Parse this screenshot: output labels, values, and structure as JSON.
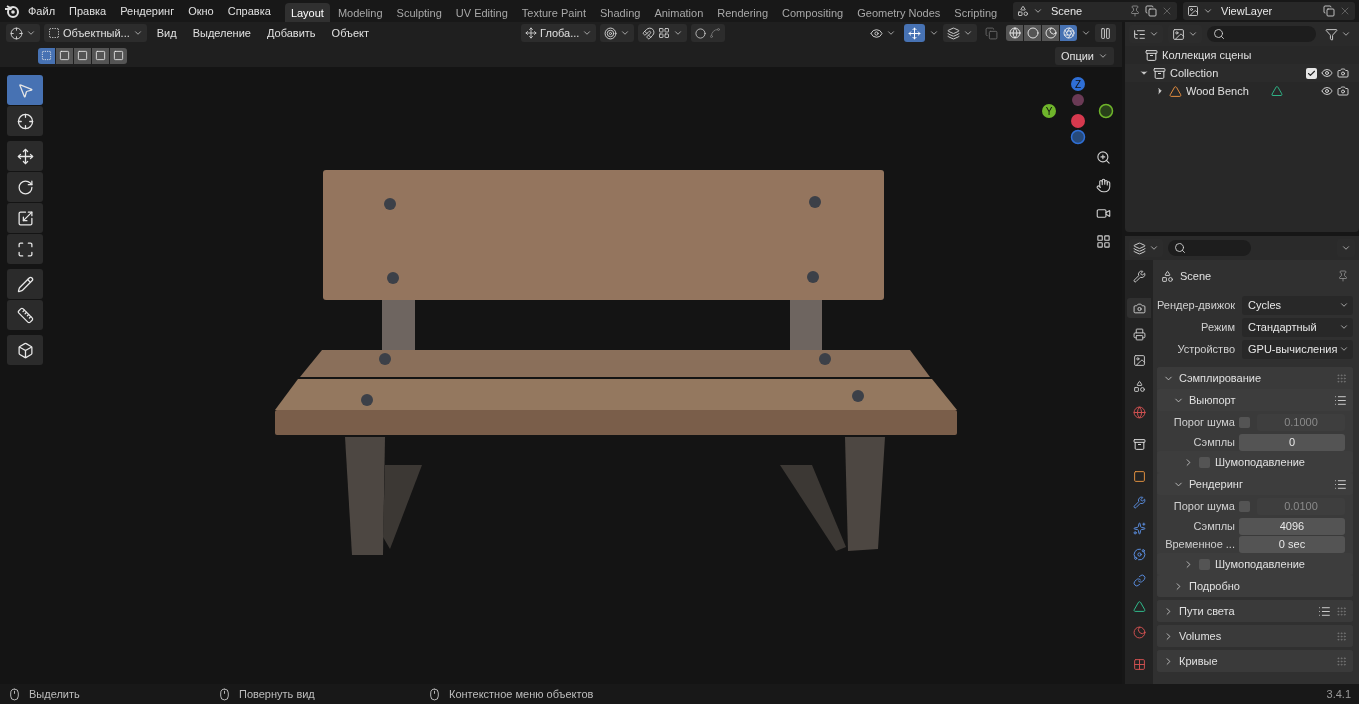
{
  "topbar": {
    "menus": [
      "Файл",
      "Правка",
      "Рендеринг",
      "Окно",
      "Справка"
    ],
    "workspaces": [
      {
        "label": "Layout",
        "selected": true
      },
      {
        "label": "Modeling",
        "selected": false
      },
      {
        "label": "Sculpting",
        "selected": false
      },
      {
        "label": "UV Editing",
        "selected": false
      },
      {
        "label": "Texture Paint",
        "selected": false
      },
      {
        "label": "Shading",
        "selected": false
      },
      {
        "label": "Animation",
        "selected": false
      },
      {
        "label": "Rendering",
        "selected": false
      },
      {
        "label": "Compositing",
        "selected": false
      },
      {
        "label": "Geometry Nodes",
        "selected": false
      },
      {
        "label": "Scripting",
        "selected": false
      }
    ],
    "scene": "Scene",
    "view_layer": "ViewLayer"
  },
  "viewport": {
    "mode": "Объектный...",
    "menus": [
      "Вид",
      "Выделение",
      "Добавить",
      "Объект"
    ],
    "orientation": "Глоба...",
    "shading": [
      {
        "selected": false
      },
      {
        "selected": false
      },
      {
        "selected": false
      },
      {
        "selected": true
      }
    ],
    "select_modes": [
      {
        "selected": true
      },
      {
        "selected": false
      },
      {
        "selected": false
      },
      {
        "selected": false
      },
      {
        "selected": false
      }
    ],
    "options": "Опции",
    "tools": [
      {
        "selected": true
      },
      {
        "selected": false
      },
      {
        "selected": false
      },
      {
        "selected": false
      },
      {
        "selected": false
      },
      {
        "selected": false
      },
      {
        "selected": false
      },
      {
        "selected": false
      },
      {
        "selected": false
      }
    ],
    "gizmo": {
      "z": "Z",
      "y": "Y"
    }
  },
  "outliner": {
    "root": "Коллекция сцены",
    "items": [
      {
        "label": "Collection",
        "expanded": true,
        "checked": true,
        "children": [
          {
            "label": "Wood Bench",
            "expanded": false
          }
        ]
      }
    ]
  },
  "properties": {
    "context": "Scene",
    "tabs": [
      {
        "selected": false
      },
      {
        "selected": true
      },
      {
        "selected": false
      },
      {
        "selected": false
      },
      {
        "selected": false
      },
      {
        "selected": false
      },
      {
        "selected": false
      },
      {
        "selected": false
      },
      {
        "selected": false
      },
      {
        "selected": false
      },
      {
        "selected": false
      },
      {
        "selected": false
      },
      {
        "selected": false
      },
      {
        "selected": false
      },
      {
        "selected": false
      }
    ],
    "fields": [
      {
        "label": "Рендер-движок",
        "value": "Cycles"
      },
      {
        "label": "Режим",
        "value": "Стандартный"
      },
      {
        "label": "Устройство",
        "value": "GPU-вычисления"
      }
    ],
    "panels": [
      {
        "kind": "panel",
        "label": "Сэмплирование",
        "expanded": true,
        "presets": false,
        "children": [
          {
            "kind": "subpanel",
            "label": "Выюпорт",
            "expanded": true,
            "presets": true,
            "children": [
              {
                "kind": "threshold",
                "label": "Порог шума",
                "checked": false,
                "value": "0.1000"
              },
              {
                "kind": "number",
                "label": "Сэмплы",
                "value": "0"
              },
              {
                "kind": "check_subpanel",
                "label": "Шумоподавление",
                "expanded": false,
                "checked": false
              }
            ]
          },
          {
            "kind": "subpanel",
            "label": "Рендеринг",
            "expanded": true,
            "presets": true,
            "children": [
              {
                "kind": "threshold",
                "label": "Порог шума",
                "checked": false,
                "value": "0.0100"
              },
              {
                "kind": "number",
                "label": "Сэмплы",
                "value": "4096"
              },
              {
                "kind": "number",
                "label": "Временное ...",
                "value": "0 sec"
              },
              {
                "kind": "check_subpanel",
                "label": "Шумоподавление",
                "expanded": false,
                "checked": false
              }
            ]
          },
          {
            "kind": "subpanel",
            "label": "Подробно",
            "expanded": false,
            "presets": false
          }
        ]
      },
      {
        "kind": "panel",
        "label": "Пути света",
        "expanded": false,
        "presets": true
      },
      {
        "kind": "panel",
        "label": "Volumes",
        "expanded": false,
        "presets": false
      },
      {
        "kind": "panel",
        "label": "Кривые",
        "expanded": false,
        "presets": false
      }
    ]
  },
  "status_bar": {
    "hints": [
      "Выделить",
      "Повернуть вид",
      "Контекстное меню объектов"
    ],
    "version": "3.4.1"
  }
}
